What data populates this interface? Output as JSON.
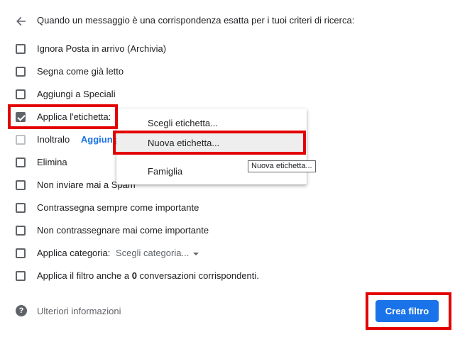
{
  "header": {
    "text": "Quando un messaggio è una corrispondenza esatta per i tuoi criteri di ricerca:"
  },
  "options": [
    {
      "label": "Ignora Posta in arrivo (Archivia)",
      "checked": false
    },
    {
      "label": "Segna come già letto",
      "checked": false
    },
    {
      "label": "Aggiungi a Speciali",
      "checked": false
    },
    {
      "label": "Applica l'etichetta:",
      "checked": true
    },
    {
      "label": "Inoltralo",
      "link": "Aggiungi",
      "checked": false,
      "disabled": true
    },
    {
      "label": "Elimina",
      "checked": false
    },
    {
      "label": "Non inviare mai a Spam",
      "checked": false
    },
    {
      "label": "Contrassegna sempre come importante",
      "checked": false
    },
    {
      "label": "Non contrassegnare mai come importante",
      "checked": false
    },
    {
      "label": "Applica categoria:",
      "select": "Scegli categoria...",
      "checked": false
    },
    {
      "label_prefix": "Applica il filtro anche a ",
      "count": "0",
      "label_suffix": " conversazioni corrispondenti.",
      "checked": false
    }
  ],
  "label_menu": {
    "items": [
      "Scegli etichetta...",
      "Nuova etichetta...",
      "Famiglia"
    ],
    "hovered": "Nuova etichetta..."
  },
  "tooltip": "Nuova etichetta...",
  "footer": {
    "help_label": "Ulteriori informazioni",
    "create_button": "Crea filtro"
  },
  "colors": {
    "accent": "#1a73e8",
    "highlight": "#e30000",
    "checkbox": "#5f6368"
  }
}
